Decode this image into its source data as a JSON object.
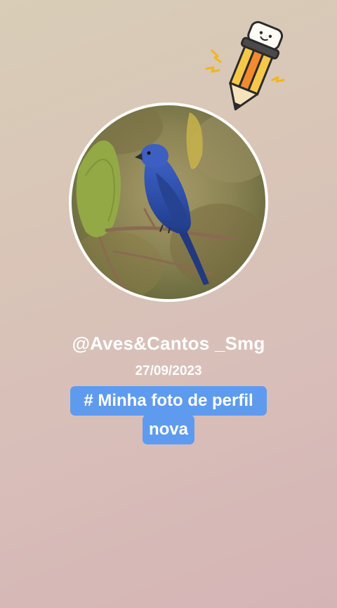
{
  "profile": {
    "username": "@Aves&Cantos _Smg",
    "date": "27/09/2023",
    "avatar_subject": "blue-songbird-on-branch"
  },
  "caption": {
    "line1": "# Minha foto de perfil",
    "line2": "nova",
    "background_color": "#5e9bef"
  },
  "sticker": {
    "icon": "pencil-sticker-icon"
  },
  "colors": {
    "text": "#ffffff",
    "background_top": "#d8cdb7",
    "background_bottom": "#d5b4b5"
  }
}
